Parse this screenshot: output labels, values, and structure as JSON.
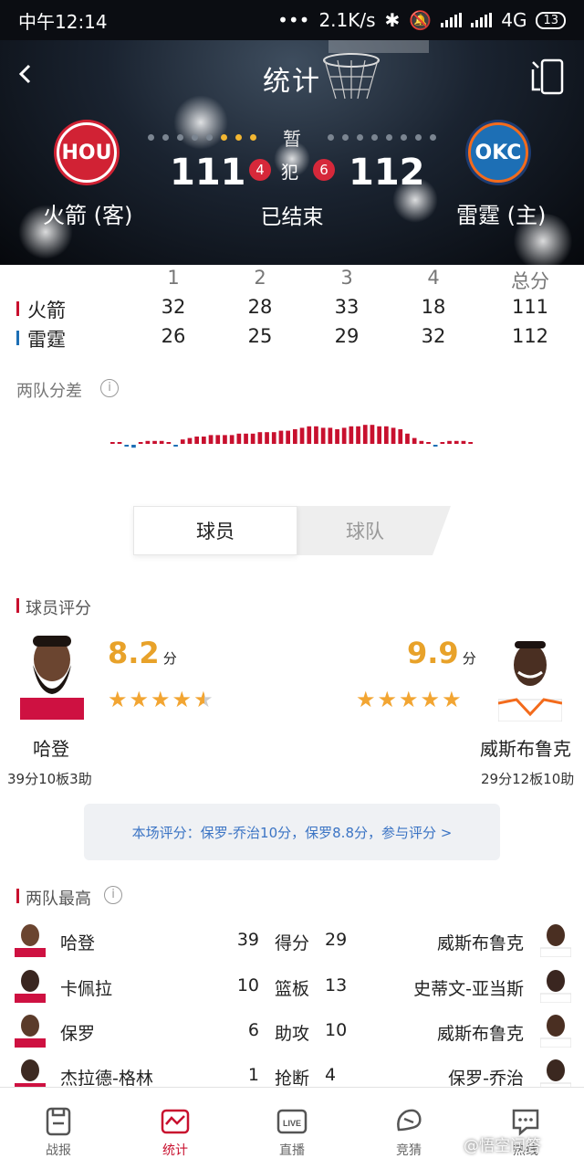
{
  "status_bar": {
    "time": "中午12:14",
    "dots": "•••",
    "speed": "2.1K/s",
    "network": "4G",
    "battery": "13"
  },
  "header": {
    "title": "统计",
    "period_label": "暂",
    "away": {
      "logo": "HOU",
      "name": "火箭 (客)",
      "score": "111",
      "fouls": "4"
    },
    "home": {
      "logo": "OKC",
      "name": "雷霆 (主)",
      "score": "112",
      "fouls": "6"
    },
    "foul_label": "犯",
    "status": "已结束"
  },
  "quarters": {
    "headers": [
      "1",
      "2",
      "3",
      "4",
      "总分"
    ],
    "rows": [
      {
        "team": "火箭",
        "scores": [
          "32",
          "28",
          "33",
          "18",
          "111"
        ]
      },
      {
        "team": "雷霆",
        "scores": [
          "26",
          "25",
          "29",
          "32",
          "112"
        ]
      }
    ]
  },
  "diff_section": {
    "title": "两队分差"
  },
  "tabs": {
    "player": "球员",
    "team": "球队"
  },
  "rating_section": {
    "title": "球员评分",
    "unit": "分",
    "left": {
      "name": "哈登",
      "rating": "8.2",
      "stars": 4.5,
      "line": "39分10板3助"
    },
    "right": {
      "name": "威斯布鲁克",
      "rating": "9.9",
      "stars": 5,
      "line": "29分12板10助"
    },
    "notice": "本场评分：保罗-乔治10分，保罗8.8分，参与评分 >"
  },
  "leaders": {
    "title": "两队最高",
    "rows": [
      {
        "left_player": "哈登",
        "left_value": "39",
        "stat": "得分",
        "right_value": "29",
        "right_player": "威斯布鲁克"
      },
      {
        "left_player": "卡佩拉",
        "left_value": "10",
        "stat": "篮板",
        "right_value": "13",
        "right_player": "史蒂文-亚当斯"
      },
      {
        "left_player": "保罗",
        "left_value": "6",
        "stat": "助攻",
        "right_value": "10",
        "right_player": "威斯布鲁克"
      },
      {
        "left_player": "杰拉德-格林",
        "left_value": "1",
        "stat": "抢断",
        "right_value": "4",
        "right_player": "保罗-乔治"
      }
    ]
  },
  "bottom_nav": [
    {
      "label": "战报",
      "icon": "report-icon"
    },
    {
      "label": "统计",
      "icon": "stats-icon",
      "active": true
    },
    {
      "label": "直播",
      "icon": "live-icon"
    },
    {
      "label": "竞猜",
      "icon": "guess-icon"
    },
    {
      "label": "热线",
      "icon": "hotline-icon"
    }
  ],
  "watermark": "@悟空问答",
  "colors": {
    "accent": "#c8102e",
    "home": "#1d6fb5",
    "star": "#f2a532",
    "rating": "#e8a22a"
  }
}
